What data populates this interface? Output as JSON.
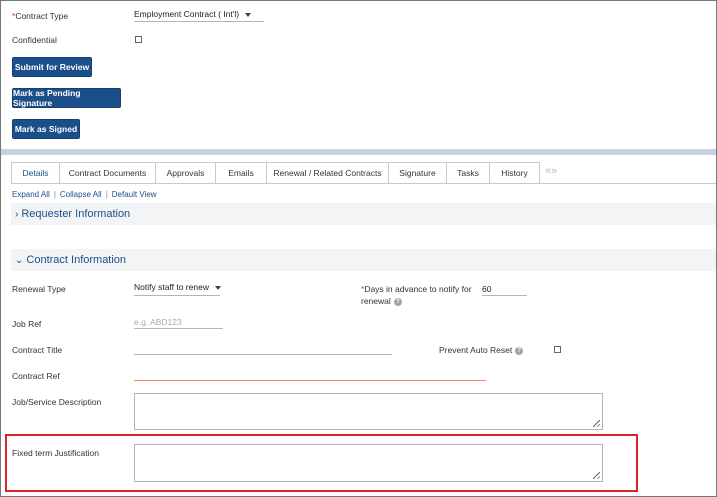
{
  "top": {
    "contract_type_label": "Contract Type",
    "required_mark": "*",
    "contract_type_value": "Employment Contract ( Int'l)",
    "confidential_label": "Confidential",
    "buttons": {
      "submit": "Submit for Review",
      "pending": "Mark as Pending Signature",
      "signed": "Mark as Signed"
    }
  },
  "tabs": [
    "Details",
    "Contract Documents",
    "Approvals",
    "Emails",
    "Renewal / Related Contracts",
    "Signature",
    "Tasks",
    "History"
  ],
  "tab_scroll": "«»",
  "links": {
    "expand": "Expand All",
    "collapse": "Collapse All",
    "default_view": "Default View",
    "separator": "|"
  },
  "sections": {
    "requester": "Requester Information",
    "contract": "Contract Information"
  },
  "form": {
    "renewal_type_label": "Renewal Type",
    "renewal_type_value": "Notify staff to renew",
    "days_advance_label_line1": "Days in advance to notify for",
    "days_advance_label_line2": "renewal",
    "days_advance_value": "60",
    "job_ref_label": "Job Ref",
    "job_ref_placeholder": "e.g. ABD123",
    "contract_title_label": "Contract Title",
    "prevent_auto_reset_label": "Prevent Auto Reset",
    "contract_ref_label": "Contract Ref",
    "job_desc_label": "Job/Service Description",
    "fixed_term_label": "Fixed term Justification",
    "help_glyph": "?"
  },
  "colors": {
    "primary": "#1b4f8a",
    "highlight": "#d8232a",
    "error_underline": "#f08a6e"
  }
}
